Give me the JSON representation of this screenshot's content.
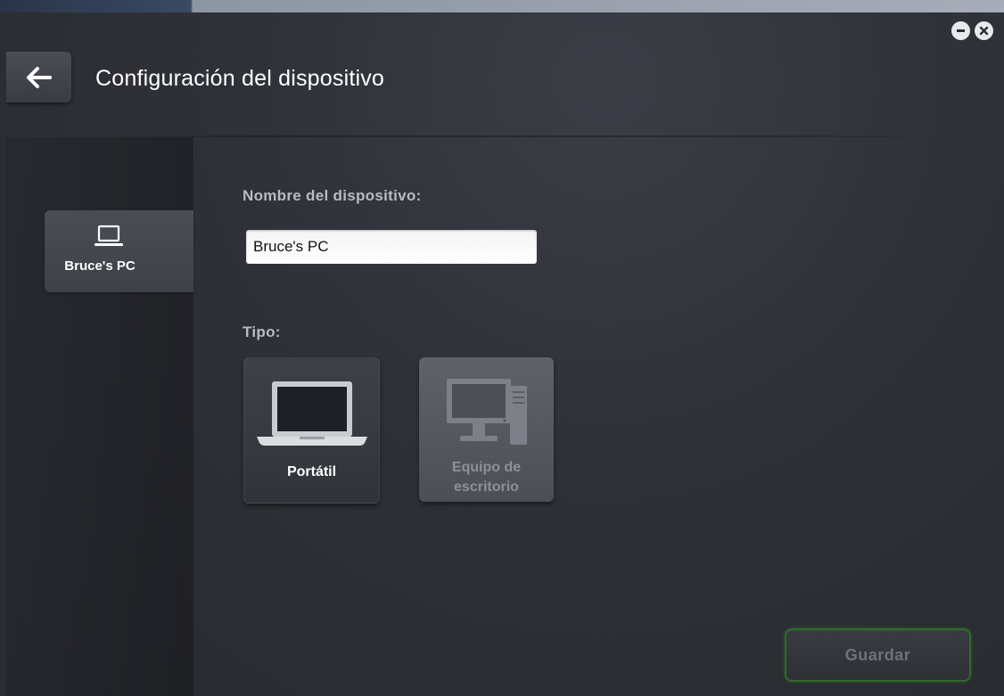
{
  "header": {
    "title": "Configuración del dispositivo",
    "back_icon": "arrow-left-icon",
    "minimize_icon": "minus-icon",
    "close_icon": "close-icon"
  },
  "sidebar": {
    "devices": [
      {
        "label": "Bruce's PC",
        "icon": "laptop-icon",
        "selected": true
      }
    ]
  },
  "form": {
    "name_label": "Nombre del dispositivo:",
    "name_value": "Bruce's PC",
    "type_label": "Tipo:",
    "types": [
      {
        "label": "Portátil",
        "icon": "laptop-icon",
        "selected": true
      },
      {
        "label_line1": "Equipo de",
        "label_line2": "escritorio",
        "icon": "desktop-computer-icon",
        "selected": false
      }
    ]
  },
  "footer": {
    "save_label": "Guardar",
    "save_border_color": "#2f6b2a"
  }
}
